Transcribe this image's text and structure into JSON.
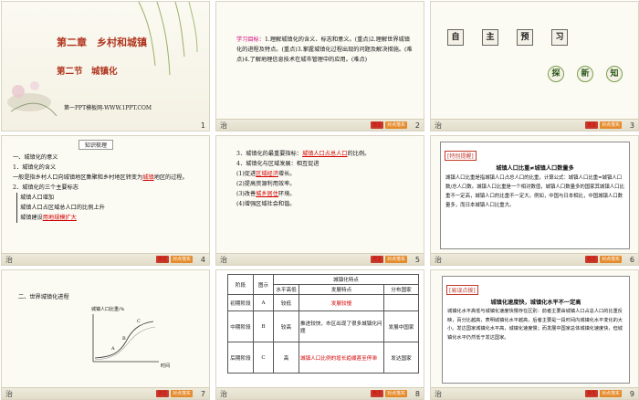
{
  "slides": [
    {
      "num": "1",
      "chapter": "第二章　乡村和城镇",
      "section": "第二节　城镇化",
      "site": "第一PPT模板网-WWW.1PPT.COM"
    },
    {
      "num": "2",
      "goals_label": "学习目标：",
      "goals_text": "1.理解城镇化的含义、标志和意义。(重点)2.理解世界城镇化的进程及特点。(重点)3.掌握城镇化过程出现的问题及解决措施。(难点)4.了解地理信息技术在城市管理中的应用。(难点)"
    },
    {
      "num": "3",
      "seals_top": [
        "自",
        "主",
        "预",
        "习"
      ],
      "seals_bottom": [
        "探",
        "新",
        "知"
      ]
    },
    {
      "num": "4",
      "badge": "知识梳理",
      "h1": "一、城镇化的意义",
      "h2": "1．城镇化的含义",
      "p1a": "一般是指乡村人口向城镇地区集聚和乡村地区转变为",
      "p1b": "城镇",
      "p1c": "地区的过程。",
      "h3": "2．城镇化的三个主要标志",
      "m1": "城镇人口增加",
      "m2": "城镇人口占区域总人口的比例上升",
      "m3a": "城镇建设",
      "m3b": "用地规模扩大"
    },
    {
      "num": "5",
      "l1a": "3．城镇化的最重要指标：",
      "l1b": "城镇人口占总人口",
      "l1c": "的比例。",
      "l2": "4．城镇化与区域发展：相互促进",
      "l3a": "(1)促进",
      "l3b": "区域经济",
      "l3c": "增长。",
      "l4": "(2)提高资源利用效率。",
      "l5a": "(3)改善",
      "l5b": "城乡居住",
      "l5c": "环境。",
      "l6": "(4)增强区域社会和谐。"
    },
    {
      "num": "6",
      "tag": "[特别提醒]",
      "title": "城镇人口比重≠城镇人口数量多",
      "body": "城镇人口比重是指城镇人口占总人口的比重，计算公式：城镇人口比重=城镇人口数/总人口数。城镇人口比重是一个相对数值，城镇人口数量多的国家其城镇人口比重不一定高，城镇人口的比重不一定大。例如，中国与日本相比，中国城镇人口数量多，而日本城镇人口比重大。"
    },
    {
      "num": "7",
      "heading": "二、世界城镇化进程",
      "ylabel": "城镇人口比重/%",
      "xlabel": "时间",
      "pts": [
        "A",
        "B",
        "C"
      ]
    },
    {
      "num": "8",
      "table_title": "城镇化特点",
      "headers": [
        "阶段",
        "图示",
        "水平高低",
        "发展特点",
        "分布国家"
      ],
      "rows": [
        [
          "初期阶段",
          "A",
          "较低",
          "发展较慢",
          ""
        ],
        [
          "中期阶段",
          "B",
          "较高",
          "推进较快，市区出现了很多城镇化问题",
          "发展中国家"
        ],
        [
          "后期阶段",
          "C",
          "高",
          "城镇人口比例的增长趋缓甚至停滞",
          "发达国家"
        ]
      ]
    },
    {
      "num": "9",
      "tag": "[易误点拨]",
      "title": "城镇化速度快，城镇化水平不一定高",
      "body": "城镇化水平高低与城镇化速度快慢存在区别：前者主要由城镇人口占总人口的比重反映，百分比越高，表明城镇化水平越高，后者主要是一段时间内城镇化水平变化的大小。发达国家城镇化水平高，城镇化速度慢；而发展中国家总体城镇化速度快，但城镇化水平仍然低于发达国家。"
    }
  ],
  "footer": {
    "left": "治",
    "btn1": "自主",
    "btn2": "对点落实"
  },
  "colors": {
    "title_red": "#b0341e",
    "highlight_red": "#d40000",
    "goal_magenta": "#d4007a"
  }
}
